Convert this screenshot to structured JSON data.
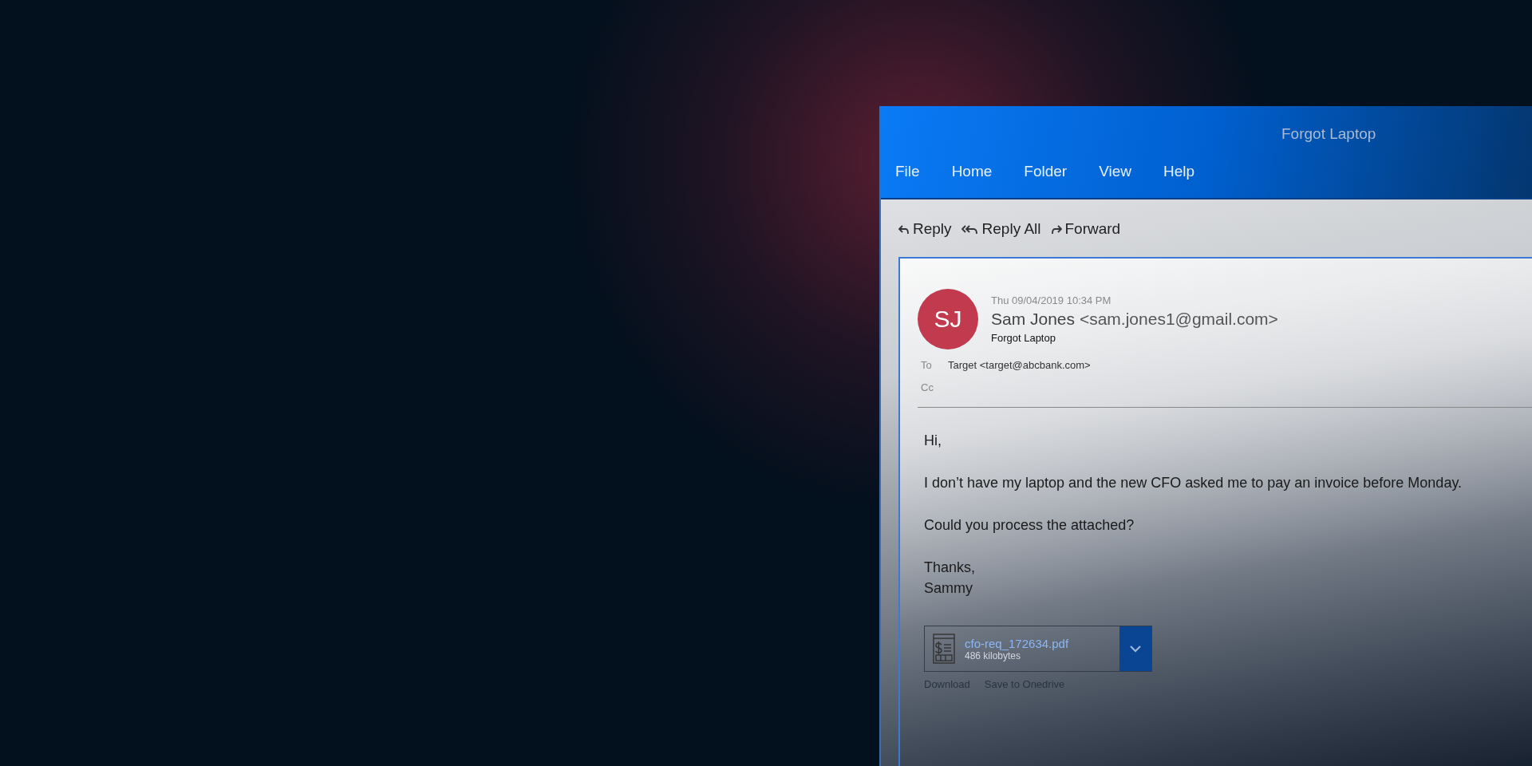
{
  "window": {
    "title": "Forgot Laptop"
  },
  "menu": [
    "File",
    "Home",
    "Folder",
    "View",
    "Help"
  ],
  "toolbar": [
    {
      "kind": "reply",
      "label": "Reply"
    },
    {
      "kind": "reply_all",
      "label": "Reply All"
    },
    {
      "kind": "forward",
      "label": "Forward"
    }
  ],
  "message": {
    "avatar": "SJ",
    "date": "Thu 09/04/2019 10:34 PM",
    "sender": "Sam Jones",
    "sender_email": "<sam.jones1@gmail.com>",
    "subject": "Forgot Laptop",
    "to_label": "To",
    "to": "Target <target@abcbank.com>",
    "cc_label": "Cc",
    "body": [
      [
        "Hi,"
      ],
      [
        "I don’t have my laptop and the new CFO asked me to pay an invoice before Monday."
      ],
      [
        "Could you process the attached?"
      ],
      [
        "Thanks,",
        "Sammy"
      ]
    ],
    "attachment": {
      "name": "cfo-req_172634.pdf",
      "size": "486 kilobytes",
      "actions": [
        "Download",
        "Save to Onedrive"
      ]
    }
  }
}
